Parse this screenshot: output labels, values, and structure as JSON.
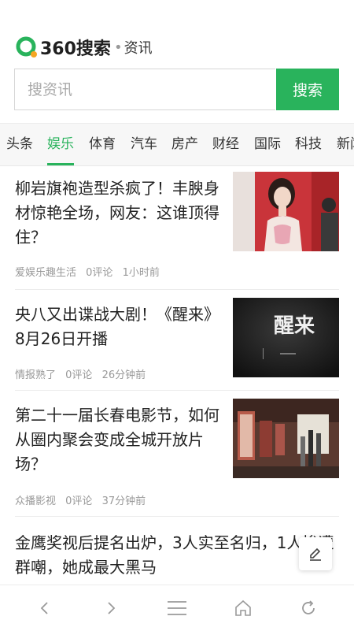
{
  "header": {
    "logo_text": "360搜索",
    "logo_dot": "•",
    "logo_sub": "资讯",
    "search_placeholder": "搜资讯",
    "search_value": "",
    "search_button": "搜索",
    "brand_color": "#29b35c"
  },
  "categories": [
    {
      "label": "头条",
      "active": false
    },
    {
      "label": "娱乐",
      "active": true
    },
    {
      "label": "体育",
      "active": false
    },
    {
      "label": "汽车",
      "active": false
    },
    {
      "label": "房产",
      "active": false
    },
    {
      "label": "财经",
      "active": false
    },
    {
      "label": "国际",
      "active": false
    },
    {
      "label": "科技",
      "active": false
    },
    {
      "label": "新闻",
      "active": false
    }
  ],
  "news": [
    {
      "title": "柳岩旗袍造型杀疯了！丰腴身材惊艳全场，网友：这谁顶得住？",
      "source": "爱娱乐趣生活",
      "comments": "0评论",
      "time": "1小时前",
      "thumb_icon": "woman-in-qipao-photo"
    },
    {
      "title": "央八又出谍战大剧！《醒来》8月26日开播",
      "source": "情报熟了",
      "comments": "0评论",
      "time": "26分钟前",
      "thumb_text": "醒来",
      "thumb_icon": "drama-poster-photo"
    },
    {
      "title": "第二十一届长春电影节，如何从圈内聚会变成全城开放片场？",
      "source": "众播影视",
      "comments": "0评论",
      "time": "37分钟前",
      "thumb_icon": "exhibition-hall-photo"
    },
    {
      "title": "金鹰奖视后提名出炉，3人实至名归，1人惨遭群嘲，她成最大黑马",
      "source": "",
      "comments": "",
      "time": ""
    }
  ],
  "toolbar": {
    "back_icon": "chevron-left-icon",
    "forward_icon": "chevron-right-icon",
    "menu_icon": "menu-icon",
    "home_icon": "home-icon",
    "refresh_icon": "refresh-icon",
    "edit_icon": "pencil-icon"
  }
}
